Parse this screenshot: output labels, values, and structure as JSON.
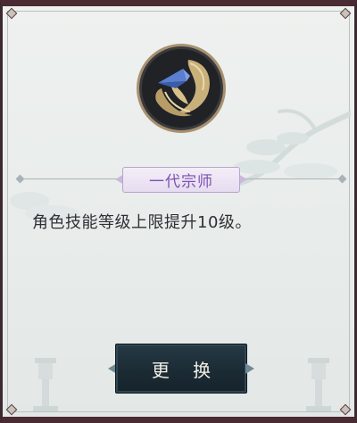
{
  "skill": {
    "title": "一代宗师",
    "description": "角色技能等级上限提升10级。",
    "emblem_icon": "gold-feather-wave-icon"
  },
  "actions": {
    "swap_label": "更 换"
  },
  "colors": {
    "frame": "#4a2a33",
    "panel_bg": "#eef1ef",
    "title_text": "#7c4fb0",
    "button_bg": "#1a2a33",
    "button_text": "#f3efe6",
    "emblem_gold": "#c9b07a"
  }
}
